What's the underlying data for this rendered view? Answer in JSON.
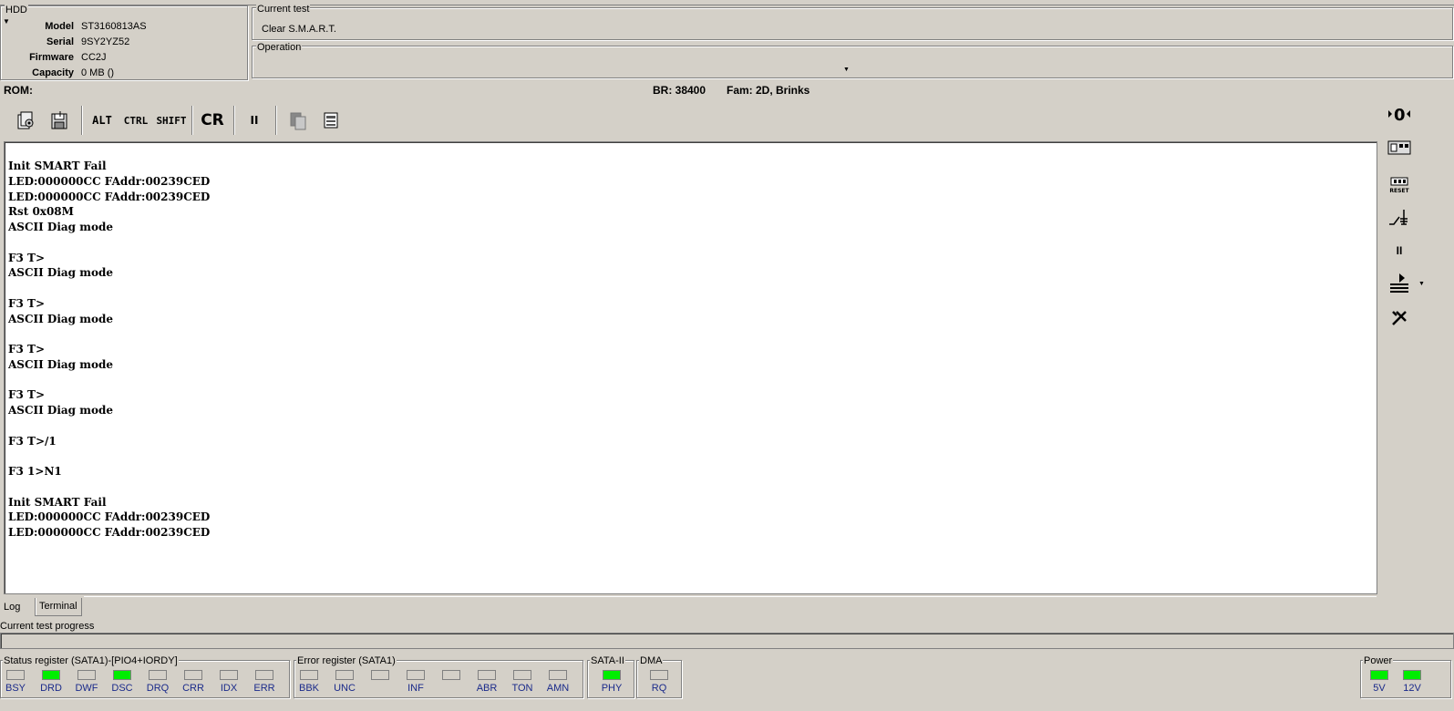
{
  "hdd": {
    "title": "HDD",
    "fields": [
      {
        "label": "Model",
        "value": "ST3160813AS"
      },
      {
        "label": "Serial",
        "value": "9SY2YZ52"
      },
      {
        "label": "Firmware",
        "value": "CC2J"
      },
      {
        "label": "Capacity",
        "value": "0 MB ()"
      }
    ]
  },
  "current_test": {
    "title": "Current test",
    "value": "Clear S.M.A.R.T."
  },
  "operation": {
    "title": "Operation",
    "value": ""
  },
  "status_line": {
    "rom": "ROM:",
    "br": "BR: 38400",
    "fam": "Fam: 2D, Brinks"
  },
  "toolbar": {
    "alt": "ALT",
    "ctrl": "CTRL",
    "shift": "SHIFT",
    "cr": "CR",
    "pause": "II"
  },
  "terminal_lines": [
    "Init SMART Fail",
    "LED:000000CC FAddr:00239CED",
    "LED:000000CC FAddr:00239CED",
    "Rst 0x08M",
    "ASCII Diag mode",
    "",
    "F3 T>",
    "ASCII Diag mode",
    "",
    "F3 T>",
    "ASCII Diag mode",
    "",
    "F3 T>",
    "ASCII Diag mode",
    "",
    "F3 T>",
    "ASCII Diag mode",
    "",
    "F3 T>/1",
    "",
    "F3 1>N1",
    "",
    "Init SMART Fail",
    "LED:000000CC FAddr:00239CED",
    "LED:000000CC FAddr:00239CED"
  ],
  "tabs": {
    "log": "Log",
    "terminal": "Terminal"
  },
  "progress": {
    "label": "Current test progress",
    "value": 0
  },
  "status_register": {
    "title": "Status register (SATA1)-[PIO4+IORDY]",
    "leds": [
      {
        "label": "BSY",
        "on": false
      },
      {
        "label": "DRD",
        "on": true
      },
      {
        "label": "DWF",
        "on": false
      },
      {
        "label": "DSC",
        "on": true
      },
      {
        "label": "DRQ",
        "on": false
      },
      {
        "label": "CRR",
        "on": false
      },
      {
        "label": "IDX",
        "on": false
      },
      {
        "label": "ERR",
        "on": false
      }
    ]
  },
  "error_register": {
    "title": "Error register (SATA1)",
    "leds": [
      {
        "label": "BBK",
        "on": false
      },
      {
        "label": "UNC",
        "on": false
      },
      {
        "label": "",
        "on": false
      },
      {
        "label": "INF",
        "on": false
      },
      {
        "label": "",
        "on": false
      },
      {
        "label": "ABR",
        "on": false
      },
      {
        "label": "TON",
        "on": false
      },
      {
        "label": "AMN",
        "on": false
      }
    ]
  },
  "sata": {
    "title": "SATA-II",
    "label": "PHY",
    "on": true
  },
  "dma": {
    "title": "DMA",
    "label": "RQ",
    "on": false
  },
  "power": {
    "title": "Power",
    "v5": "5V",
    "v12": "12V",
    "v5_on": true,
    "v12_on": true
  },
  "colors": {
    "led_on": "#00ee00",
    "led_label": "#1a2a8a",
    "window_bg": "#d4d0c8"
  }
}
